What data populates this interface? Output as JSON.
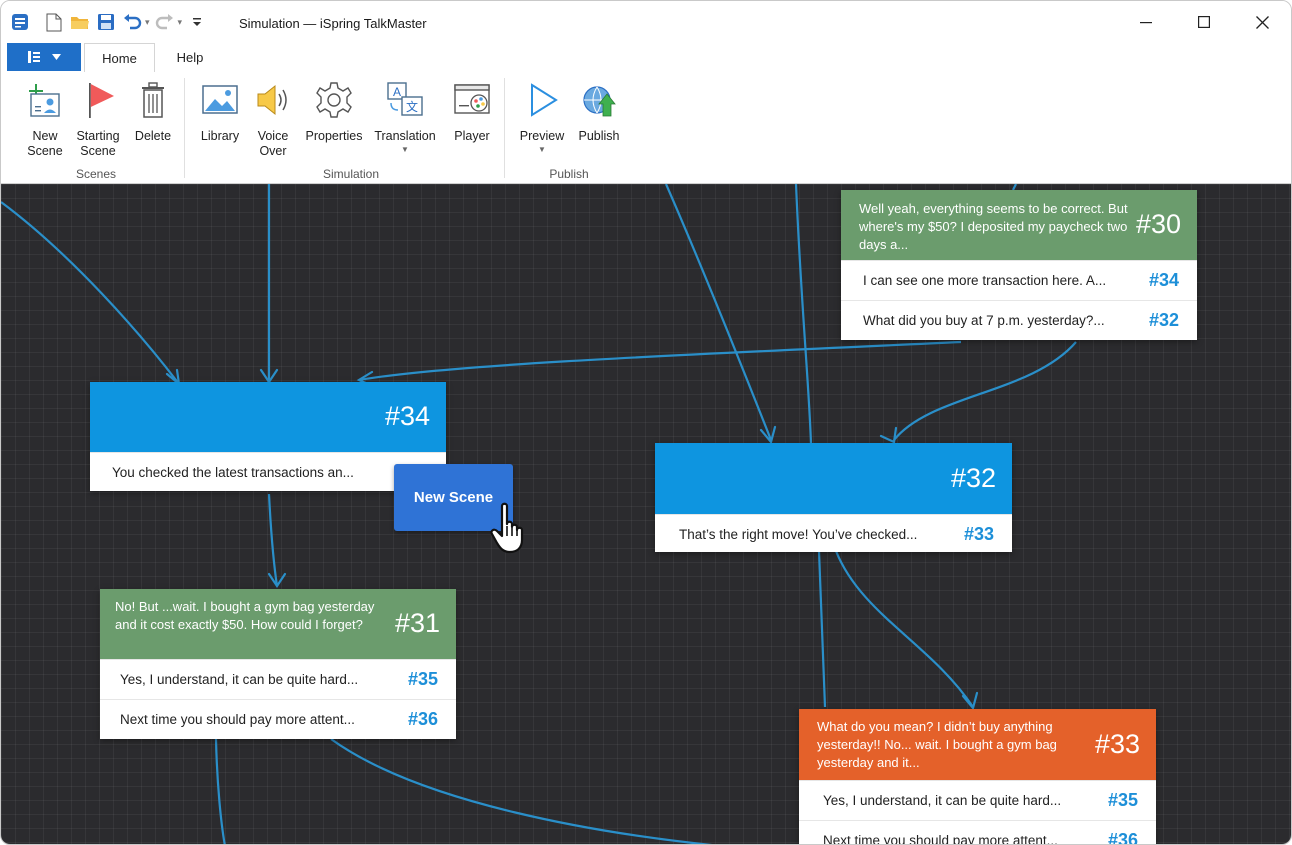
{
  "window": {
    "title": "Simulation — iSpring TalkMaster"
  },
  "tabs": {
    "home": "Home",
    "help": "Help"
  },
  "ribbon": {
    "new_scene": "New\nScene",
    "starting_scene": "Starting\nScene",
    "delete": "Delete",
    "library": "Library",
    "voice_over": "Voice\nOver",
    "properties": "Properties",
    "translation": "Translation",
    "player": "Player",
    "preview": "Preview",
    "publish": "Publish",
    "groups": {
      "scenes": "Scenes",
      "simulation": "Simulation",
      "publish": "Publish"
    }
  },
  "colors": {
    "accent": "#1f6fc8",
    "green": "#6b9c6d",
    "blue": "#0e95e0",
    "orange": "#e4612a",
    "link": "#2a8fc9",
    "canvas": "#2b2b2e"
  },
  "scenes": {
    "s30": {
      "text": "Well yeah, everything seems to be correct. But where's my $50? I deposited my paycheck two days a...",
      "num": "#30",
      "rows": [
        {
          "text": "I can see one more transaction here. A...",
          "num": "#34"
        },
        {
          "text": "What did you buy at 7 p.m. yesterday?...",
          "num": "#32"
        }
      ]
    },
    "s34": {
      "num": "#34",
      "rows": [
        {
          "text": "You checked the latest transactions an...",
          "num": ""
        }
      ]
    },
    "s32": {
      "num": "#32",
      "rows": [
        {
          "text": "That’s the right move! You’ve checked...",
          "num": "#33"
        }
      ]
    },
    "s31": {
      "text": "No! But ...wait. I bought a gym bag yesterday and it cost exactly $50. How could I forget?",
      "num": "#31",
      "rows": [
        {
          "text": "Yes,  I understand, it can be quite hard...",
          "num": "#35"
        },
        {
          "text": "Next time you should pay more attent...",
          "num": "#36"
        }
      ]
    },
    "s33": {
      "text": "What do you mean? I didn’t buy anything yesterday!! No... wait. I bought a gym bag yesterday and it...",
      "num": "#33",
      "rows": [
        {
          "text": "Yes, I understand, it can be quite hard...",
          "num": "#35"
        },
        {
          "text": "Next time you should pay more attent...",
          "num": "#36"
        }
      ]
    }
  },
  "tooltip": {
    "label": "New Scene"
  }
}
